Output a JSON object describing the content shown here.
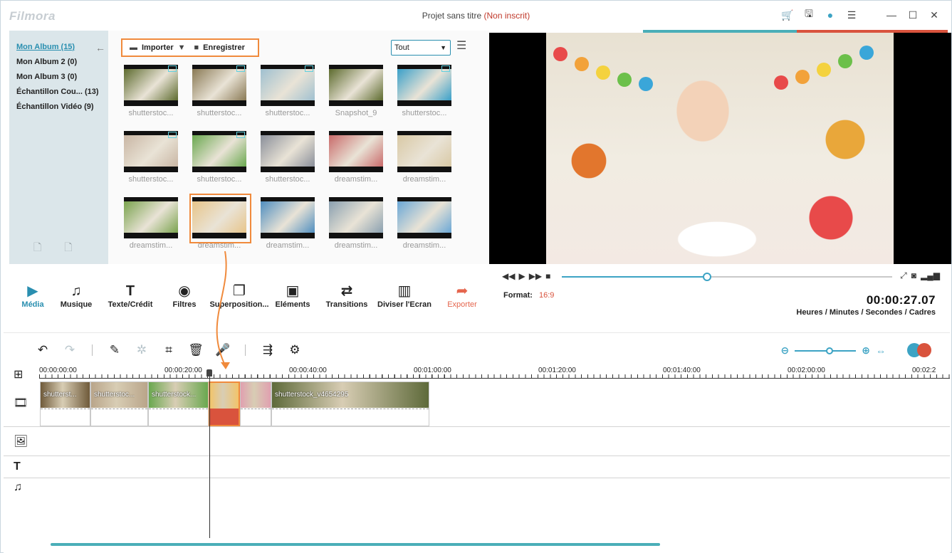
{
  "window": {
    "logo": "Filmora",
    "title": "Projet sans titre",
    "title_status": "(Non inscrit)"
  },
  "titlebar_icons": [
    "cart-icon",
    "save-icon",
    "chat-icon",
    "menu-list-icon",
    "minimize-icon",
    "maximize-icon",
    "close-icon"
  ],
  "albums": [
    {
      "label": "Mon Album (15)",
      "active": true
    },
    {
      "label": "Mon Album 2 (0)"
    },
    {
      "label": "Mon Album 3 (0)"
    },
    {
      "label": "Échantillon Cou... (13)"
    },
    {
      "label": "Échantillon Vidéo (9)"
    }
  ],
  "media_bar": {
    "import_label": "Importer",
    "record_label": "Enregistrer",
    "filter_value": "Tout"
  },
  "media_items": [
    {
      "label": "shutterstoc...",
      "color": "#5d6b2e",
      "badge": true
    },
    {
      "label": "shutterstoc...",
      "color": "#8a7a55",
      "badge": true
    },
    {
      "label": "shutterstoc...",
      "color": "#9fc0d0",
      "badge": true
    },
    {
      "label": "Snapshot_9",
      "color": "#5d6b2e",
      "badge": false
    },
    {
      "label": "shutterstoc...",
      "color": "#3aa0c9",
      "badge": true
    },
    {
      "label": "shutterstoc...",
      "color": "#c9b6a4",
      "badge": true
    },
    {
      "label": "shutterstoc...",
      "color": "#6aa84f",
      "badge": true
    },
    {
      "label": "shutterstoc...",
      "color": "#8a8f9a",
      "badge": false
    },
    {
      "label": "dreamstim...",
      "color": "#c96a6a",
      "badge": false
    },
    {
      "label": "dreamstim...",
      "color": "#d9c9a5",
      "badge": false
    },
    {
      "label": "dreamstim...",
      "color": "#7aa34e",
      "badge": false
    },
    {
      "label": "dreamstim...",
      "color": "#e8c58a",
      "badge": false
    },
    {
      "label": "dreamstim...",
      "color": "#4f8ec0",
      "badge": false
    },
    {
      "label": "dreamstim...",
      "color": "#8aa0b0",
      "badge": false
    },
    {
      "label": "dreamstim...",
      "color": "#6aa7d6",
      "badge": false
    }
  ],
  "tools": [
    {
      "label": "Média",
      "icon": "▶",
      "name": "tool-media",
      "active": true
    },
    {
      "label": "Musique",
      "icon": "♫",
      "name": "tool-music"
    },
    {
      "label": "Texte/Crédit",
      "icon": "T",
      "name": "tool-text"
    },
    {
      "label": "Filtres",
      "icon": "◉",
      "name": "tool-filters"
    },
    {
      "label": "Superposition...",
      "icon": "❐",
      "name": "tool-overlay"
    },
    {
      "label": "Eléments",
      "icon": "▣",
      "name": "tool-elements"
    },
    {
      "label": "Transitions",
      "icon": "⇄",
      "name": "tool-transitions"
    },
    {
      "label": "Diviser l'Ecran",
      "icon": "▥",
      "name": "tool-split-screen"
    },
    {
      "label": "Exporter",
      "icon": "➦",
      "name": "tool-export",
      "export": true
    }
  ],
  "preview": {
    "format_label": "Format:",
    "format_value": "16:9",
    "timecode": "00:00:27.07",
    "timecode_units": "Heures / Minutes / Secondes / Cadres",
    "progress": 0.44
  },
  "ruler": [
    {
      "label": "00:00:00:00"
    },
    {
      "label": "00:00:20:00"
    },
    {
      "label": "00:00:40:00"
    },
    {
      "label": "00:01:00:00"
    },
    {
      "label": "00:01:20:00"
    },
    {
      "label": "00:01:40:00"
    },
    {
      "label": "00:02:00:00"
    },
    {
      "label": "00:02:2"
    }
  ],
  "clips": [
    {
      "label": "shutterst..."
    },
    {
      "label": "shutterstoc..."
    },
    {
      "label": "shutterstock..."
    },
    {
      "label": "",
      "selected": true
    },
    {
      "label": ""
    },
    {
      "label": "shutterstock_v4654295"
    }
  ],
  "colors": {
    "accent": "#3ca3c4",
    "highlight": "#f08a3c",
    "export": "#e5654d"
  }
}
